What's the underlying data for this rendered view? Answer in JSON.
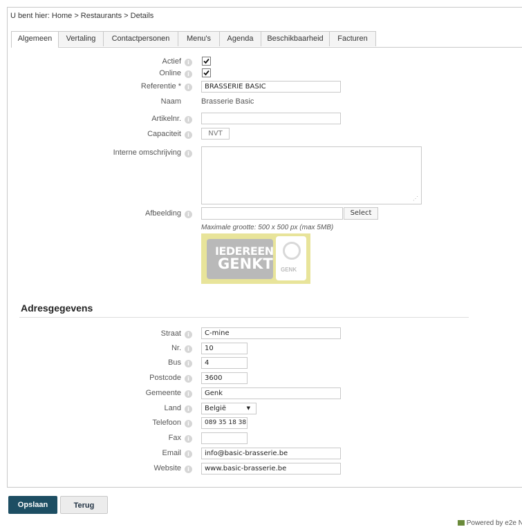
{
  "breadcrumb": "U bent hier: Home > Restaurants > Details",
  "tabs": [
    "Algemeen",
    "Vertaling",
    "Contactpersonen",
    "Menu's",
    "Agenda",
    "Beschikbaarheid",
    "Facturen"
  ],
  "general": {
    "actief_label": "Actief",
    "actief_checked": true,
    "online_label": "Online",
    "online_checked": true,
    "referentie_label": "Referentie *",
    "referentie_value": "BRASSERIE BASIC",
    "naam_label": "Naam",
    "naam_value": "Brasserie Basic",
    "artikelnr_label": "Artikelnr.",
    "artikelnr_value": "",
    "capaciteit_label": "Capaciteit",
    "capaciteit_value": "NVT",
    "omschrijving_label": "Interne omschrijving",
    "omschrijving_value": "",
    "afbeelding_label": "Afbeelding",
    "afbeelding_value": "",
    "select_label": "Select",
    "max_size_note": "Maximale grootte: 500 x 500 px (max 5MB)",
    "image_text_line1": "IEDEREEN",
    "image_text_line2": "GENKT",
    "image_text_badge": "GENK"
  },
  "address": {
    "title": "Adresgegevens",
    "fields": [
      {
        "label": "Straat",
        "value": "C-mine"
      },
      {
        "label": "Nr.",
        "value": "10"
      },
      {
        "label": "Bus",
        "value": "4"
      },
      {
        "label": "Postcode",
        "value": "3600"
      },
      {
        "label": "Gemeente",
        "value": "Genk"
      },
      {
        "label": "Land",
        "value": "België"
      },
      {
        "label": "Telefoon",
        "value": "089 35 18 38"
      },
      {
        "label": "Fax",
        "value": ""
      },
      {
        "label": "Email",
        "value": "info@basic-brasserie.be"
      },
      {
        "label": "Website",
        "value": "www.basic-brasserie.be"
      }
    ]
  },
  "buttons": {
    "save": "Opslaan",
    "back": "Terug"
  },
  "footer": "Powered by e2e N",
  "colors": {
    "primary_button": "#1d4e63",
    "image_bg": "#e8e49a",
    "image_panel": "#b9b9b9"
  }
}
